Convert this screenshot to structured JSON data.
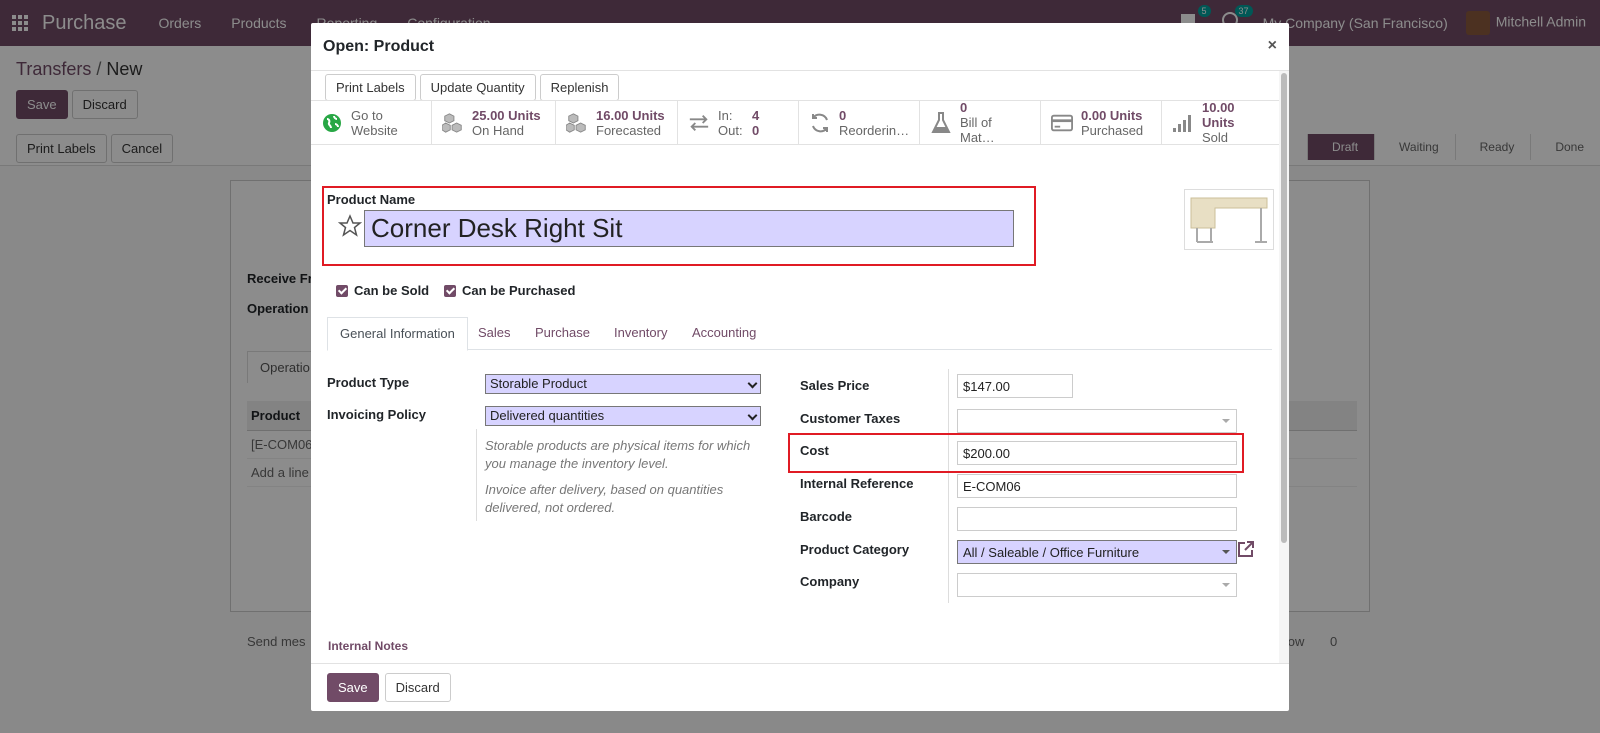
{
  "navbar": {
    "brand": "Purchase",
    "menu": [
      "Orders",
      "Products",
      "Reporting",
      "Configuration"
    ],
    "messages_count": "5",
    "activities_count": "37",
    "company": "My Company (San Francisco)",
    "user": "Mitchell Admin"
  },
  "control_panel": {
    "breadcrumb_parent": "Transfers",
    "breadcrumb_current": "New",
    "save_label": "Save",
    "discard_label": "Discard",
    "print_labels_label": "Print Labels",
    "cancel_label": "Cancel",
    "stages": [
      "Draft",
      "Waiting",
      "Ready",
      "Done"
    ],
    "active_stage": "Draft"
  },
  "sheet": {
    "receive_from_label": "Receive Fr",
    "operation_label": "Operation",
    "tab_label": "Operatio",
    "column_product": "Product",
    "row_product": "[E-COM06",
    "add_line": "Add a line",
    "send_message": "Send mes",
    "follow": "llow",
    "followers": "0"
  },
  "modal": {
    "title": "Open: Product",
    "close": "×",
    "header_buttons": [
      "Print Labels",
      "Update Quantity",
      "Replenish"
    ],
    "smart_buttons": [
      {
        "icon": "globe-icon",
        "value": "Go to",
        "label": "Website"
      },
      {
        "icon": "cubes-icon",
        "value": "25.00 Units",
        "label": "On Hand"
      },
      {
        "icon": "cubes-icon",
        "value": "16.00 Units",
        "label": "Forecasted"
      },
      {
        "icon": "exchange-icon",
        "in_label": "In:",
        "in_value": "4",
        "out_label": "Out:",
        "out_value": "0"
      },
      {
        "icon": "refresh-icon",
        "value": "0",
        "label": "Reorderin…"
      },
      {
        "icon": "flask-icon",
        "value": "0",
        "label": "Bill of Mat…"
      },
      {
        "icon": "credit-card-icon",
        "value": "0.00 Units",
        "label": "Purchased"
      },
      {
        "icon": "signal-icon",
        "value": "10.00 Units",
        "label": "Sold"
      }
    ],
    "product_name_label": "Product Name",
    "product_name": "Corner Desk Right Sit",
    "can_be_sold": "Can be Sold",
    "can_be_purchased": "Can be Purchased",
    "tabs": [
      "General Information",
      "Sales",
      "Purchase",
      "Inventory",
      "Accounting"
    ],
    "active_tab": "General Information",
    "left": {
      "product_type_label": "Product Type",
      "product_type": "Storable Product",
      "invoicing_policy_label": "Invoicing Policy",
      "invoicing_policy": "Delivered quantities",
      "help1_line1": "Storable products are physical items for which",
      "help1_line2": "you manage the inventory level.",
      "help2_line1": "Invoice after delivery, based on quantities",
      "help2_line2": "delivered, not ordered."
    },
    "right": {
      "sales_price_label": "Sales Price",
      "sales_price": "$147.00",
      "customer_taxes_label": "Customer Taxes",
      "customer_taxes": "",
      "cost_label": "Cost",
      "cost": "$200.00",
      "internal_ref_label": "Internal Reference",
      "internal_ref": "E-COM06",
      "barcode_label": "Barcode",
      "barcode": "",
      "category_label": "Product Category",
      "category": "All / Saleable / Office Furniture",
      "company_label": "Company",
      "company": ""
    },
    "internal_notes": "Internal Notes",
    "footer_save": "Save",
    "footer_discard": "Discard"
  },
  "colors": {
    "brand": "#714B67",
    "highlight_field": "#d7d3ff",
    "annotation_red": "#e01b24"
  }
}
